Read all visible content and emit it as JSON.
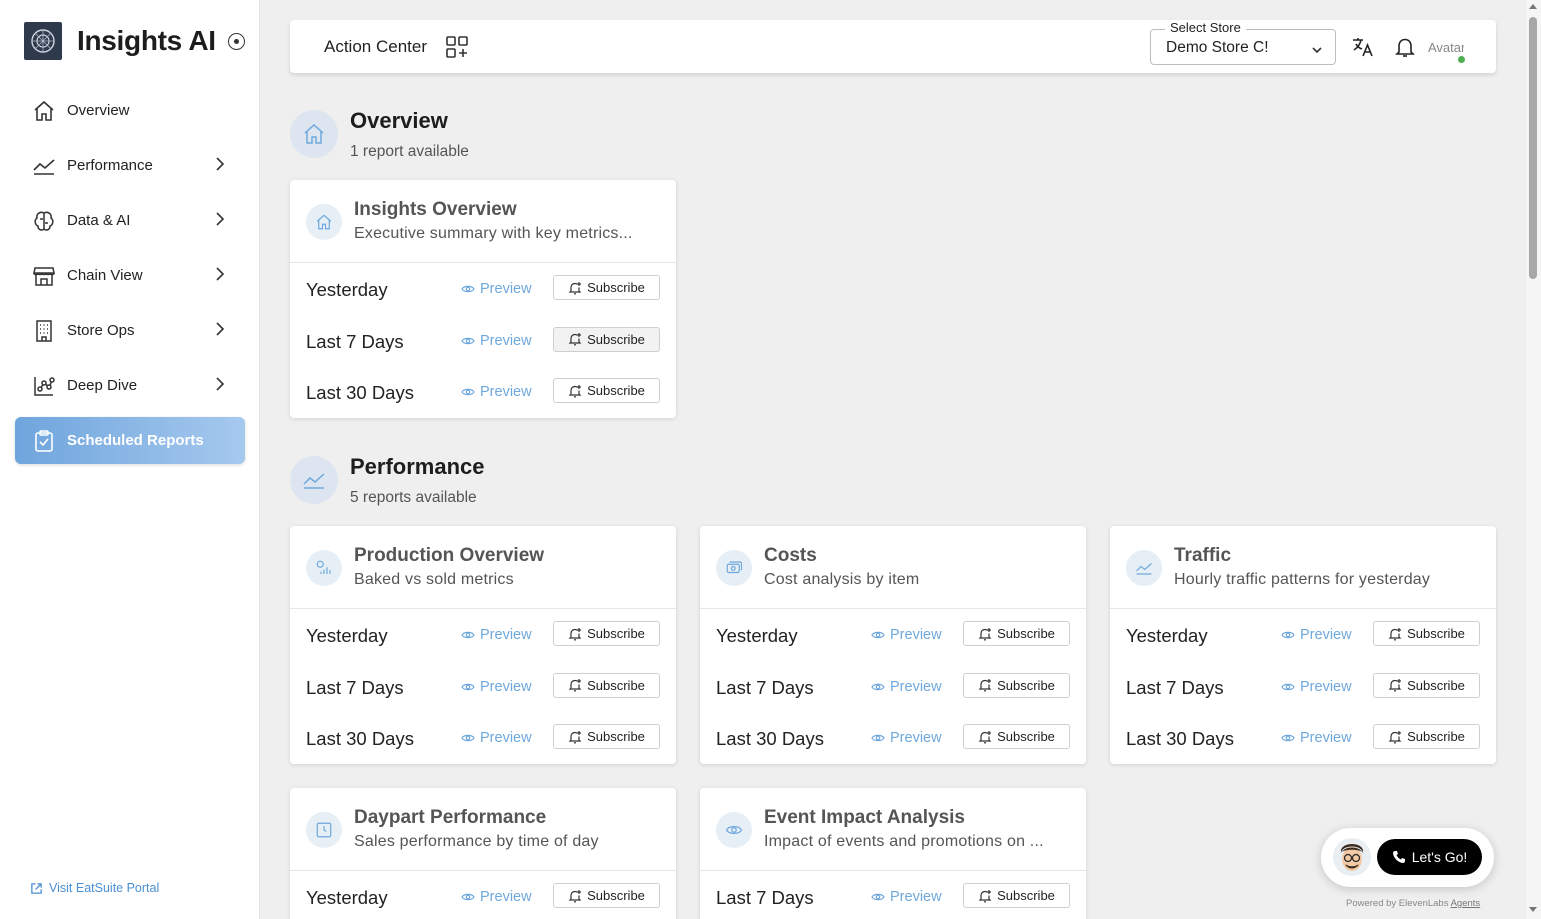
{
  "app": {
    "title": "Insights AI",
    "portal_link": "Visit EatSuite Portal"
  },
  "sidebar": {
    "items": [
      {
        "label": "Overview",
        "icon": "home-icon",
        "has_submenu": false
      },
      {
        "label": "Performance",
        "icon": "chart-line-icon",
        "has_submenu": true
      },
      {
        "label": "Data & AI",
        "icon": "brain-icon",
        "has_submenu": true
      },
      {
        "label": "Chain View",
        "icon": "store-icon",
        "has_submenu": true
      },
      {
        "label": "Store Ops",
        "icon": "building-icon",
        "has_submenu": true
      },
      {
        "label": "Deep Dive",
        "icon": "graph-icon",
        "has_submenu": true
      },
      {
        "label": "Scheduled Reports",
        "icon": "clipboard-icon",
        "has_submenu": false,
        "active": true
      }
    ]
  },
  "header": {
    "action_center": "Action Center",
    "store_label": "Select Store",
    "store_value": "Demo Store C!",
    "avatar_alt": "Avatar"
  },
  "common": {
    "preview": "Preview",
    "subscribe": "Subscribe"
  },
  "sections": [
    {
      "title": "Overview",
      "subtitle": "1 report available",
      "icon": "home-icon",
      "cards": [
        {
          "title": "Insights Overview",
          "desc": "Executive summary with key metrics...",
          "icon": "home-icon",
          "rows": [
            "Yesterday",
            "Last 7 Days",
            "Last 30 Days"
          ]
        }
      ]
    },
    {
      "title": "Performance",
      "subtitle": "5 reports available",
      "icon": "chart-line-icon",
      "cards": [
        {
          "title": "Production Overview",
          "desc": "Baked vs sold metrics",
          "icon": "chart-bar-icon",
          "rows": [
            "Yesterday",
            "Last 7 Days",
            "Last 30 Days"
          ]
        },
        {
          "title": "Costs",
          "desc": "Cost analysis by item",
          "icon": "money-icon",
          "rows": [
            "Yesterday",
            "Last 7 Days",
            "Last 30 Days"
          ]
        },
        {
          "title": "Traffic",
          "desc": "Hourly traffic patterns for yesterday",
          "icon": "chart-line-icon",
          "rows": [
            "Yesterday",
            "Last 7 Days",
            "Last 30 Days"
          ]
        },
        {
          "title": "Daypart Performance",
          "desc": "Sales performance by time of day",
          "icon": "clock-icon",
          "rows": [
            "Yesterday"
          ]
        },
        {
          "title": "Event Impact Analysis",
          "desc": "Impact of events and promotions on ...",
          "icon": "eye-icon",
          "rows": [
            "Last 7 Days"
          ]
        }
      ]
    }
  ],
  "voice_widget": {
    "button": "Let's Go!",
    "powered_by": "Powered by ElevenLabs",
    "powered_link": "Agents"
  },
  "colors": {
    "accent": "#6fa8dc",
    "active_nav": "#7aaee0",
    "link": "#4a8fd4"
  }
}
